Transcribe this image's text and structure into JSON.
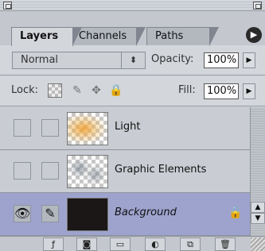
{
  "tabs": [
    {
      "label": "Layers",
      "active": true
    },
    {
      "label": "Channels",
      "active": false
    },
    {
      "label": "Paths",
      "active": false
    }
  ],
  "panel_menu": {
    "icon": "panel-menu-arrow-icon"
  },
  "blend": {
    "mode": "Normal",
    "opacity_label": "Opacity:",
    "opacity_value": "100%"
  },
  "lock": {
    "label": "Lock:",
    "fill_label": "Fill:",
    "fill_value": "100%"
  },
  "layers": [
    {
      "name": "Light",
      "visible": false,
      "selected": false,
      "locked": false
    },
    {
      "name": "Graphic Elements",
      "visible": false,
      "selected": false,
      "locked": false
    },
    {
      "name": "Background",
      "visible": true,
      "selected": true,
      "locked": true
    }
  ],
  "colors": {
    "selected_row": "#9da3cd",
    "panel_bg": "#c9cdd3"
  }
}
